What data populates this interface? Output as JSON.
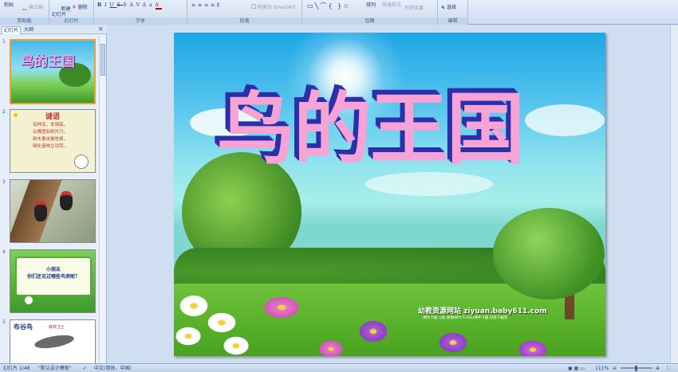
{
  "ribbon": {
    "paste_label": "粘贴",
    "format_painter_label": "格式刷",
    "new_slide_label": "新建\n幻灯片",
    "delete_label": "删除",
    "group_clipboard": "剪贴板",
    "group_slides": "幻灯片",
    "group_font": "字体",
    "group_paragraph": "段落",
    "group_drawing": "绘图",
    "group_editing": "编辑",
    "smartart_label": "转换为 SmartArt",
    "arrange_label": "排列",
    "quick_styles_label": "快速样式",
    "shape_effects_label": "形状效果",
    "select_label": "选择"
  },
  "pane": {
    "tab_slides": "幻灯片",
    "tab_outline": "大纲",
    "close": "×"
  },
  "thumbnails": [
    {
      "num": "1",
      "title": "鸟的王国"
    },
    {
      "num": "2",
      "title": "谜语",
      "lines": [
        "有种鸟，本领高，",
        "尖嘴莹伯树开刀，",
        "树木害虫被吃掉，",
        "绿化造林立功劳。"
      ]
    },
    {
      "num": "3"
    },
    {
      "num": "4",
      "lines": [
        "小朋友",
        "你们还见过哪些鸟类呢？"
      ]
    },
    {
      "num": "5",
      "title": "布谷鸟",
      "caption": "森林卫士"
    }
  ],
  "slide": {
    "title": "鸟的王国",
    "watermark_site": "幼教资源网站 ziyuan.baby611.com",
    "watermark_sub": "课件下载  儿歌  故事MP3  FLASH课件下载  试卷下载等"
  },
  "status": {
    "slide_counter": "幻灯片 1/48",
    "theme": "\"默认设计模板\"",
    "language": "中文(简体，中国)",
    "zoom": "111%"
  },
  "colors": {
    "title_fill": "#f7a3d6",
    "title_shadow": "#2b2fa8",
    "selection": "#f0a030"
  }
}
